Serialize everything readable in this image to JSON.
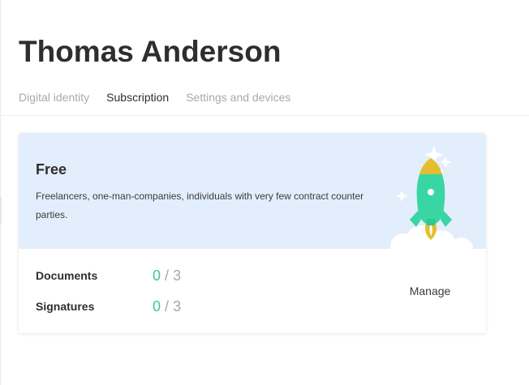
{
  "profile": {
    "name": "Thomas Anderson"
  },
  "tabs": [
    {
      "label": "Digital identity",
      "active": false
    },
    {
      "label": "Subscription",
      "active": true
    },
    {
      "label": "Settings and devices",
      "active": false
    }
  ],
  "subscription": {
    "plan_name": "Free",
    "description": "Freelancers, one-man-companies, individuals with very few contract counter parties.",
    "illustration": "rocket-launch-icon",
    "usage": {
      "documents": {
        "label": "Documents",
        "used": "0",
        "separator": "/",
        "limit": "3"
      },
      "signatures": {
        "label": "Signatures",
        "used": "0",
        "separator": "/",
        "limit": "3"
      }
    },
    "manage_label": "Manage"
  },
  "colors": {
    "accent_green": "#3cc7a0",
    "banner_blue": "#e3eefc",
    "muted_gray": "#a9a9a9",
    "rocket_green": "#39d6a3",
    "rocket_yellow": "#e5bd2f",
    "cloud_white": "#ffffff"
  }
}
